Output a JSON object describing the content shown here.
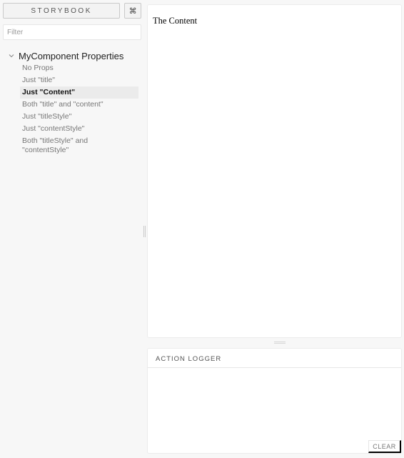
{
  "sidebar": {
    "brand_label": "STORYBOOK",
    "shortcut_label": "⌘",
    "filter_placeholder": "Filter",
    "kind_label": "MyComponent Properties",
    "stories": [
      "No Props",
      "Just \"title\"",
      "Just \"Content\"",
      "Both \"title\" and \"content\"",
      "Just \"titleStyle\"",
      "Just \"contentStyle\"",
      "Both \"titleStyle\" and \"contentStyle\""
    ],
    "selected_story": "Just \"Content\""
  },
  "preview": {
    "content_text": "The Content"
  },
  "addon": {
    "tab_label": "ACTION LOGGER",
    "clear_label": "CLEAR"
  }
}
